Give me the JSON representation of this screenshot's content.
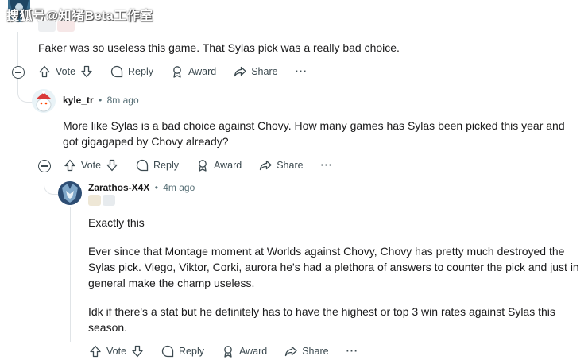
{
  "watermark": "搜狐号@知猪Beta工作室",
  "comments": [
    {
      "text": "Faker was so useless this game. That Sylas pick was a really bad choice.",
      "actions": {
        "vote": "Vote",
        "reply": "Reply",
        "award": "Award",
        "share": "Share",
        "more": "···"
      }
    },
    {
      "username": "kyle_tr",
      "time": "8m ago",
      "text": "More like Sylas is a bad choice against Chovy. How many games has Sylas been picked this year and got gigagaped by Chovy already?",
      "actions": {
        "vote": "Vote",
        "reply": "Reply",
        "award": "Award",
        "share": "Share",
        "more": "···"
      }
    },
    {
      "username": "Zarathos-X4X",
      "time": "4m ago",
      "paragraphs": [
        "Exactly this",
        "Ever since that Montage moment at Worlds against Chovy, Chovy has pretty much destroyed the Sylas pick. Viego, Viktor, Corki, aurora he's had a plethora of answers to counter the pick and just in general make the champ useless.",
        "Idk if there's a stat but he definitely has to have the highest or top 3 win rates against Sylas this season."
      ],
      "actions": {
        "vote": "Vote",
        "reply": "Reply",
        "award": "Award",
        "share": "Share",
        "more": "···"
      }
    }
  ],
  "separator": "•",
  "colors": {
    "line": "#e0e4e7",
    "meta": "#576f76",
    "action": "#3c4a50"
  }
}
